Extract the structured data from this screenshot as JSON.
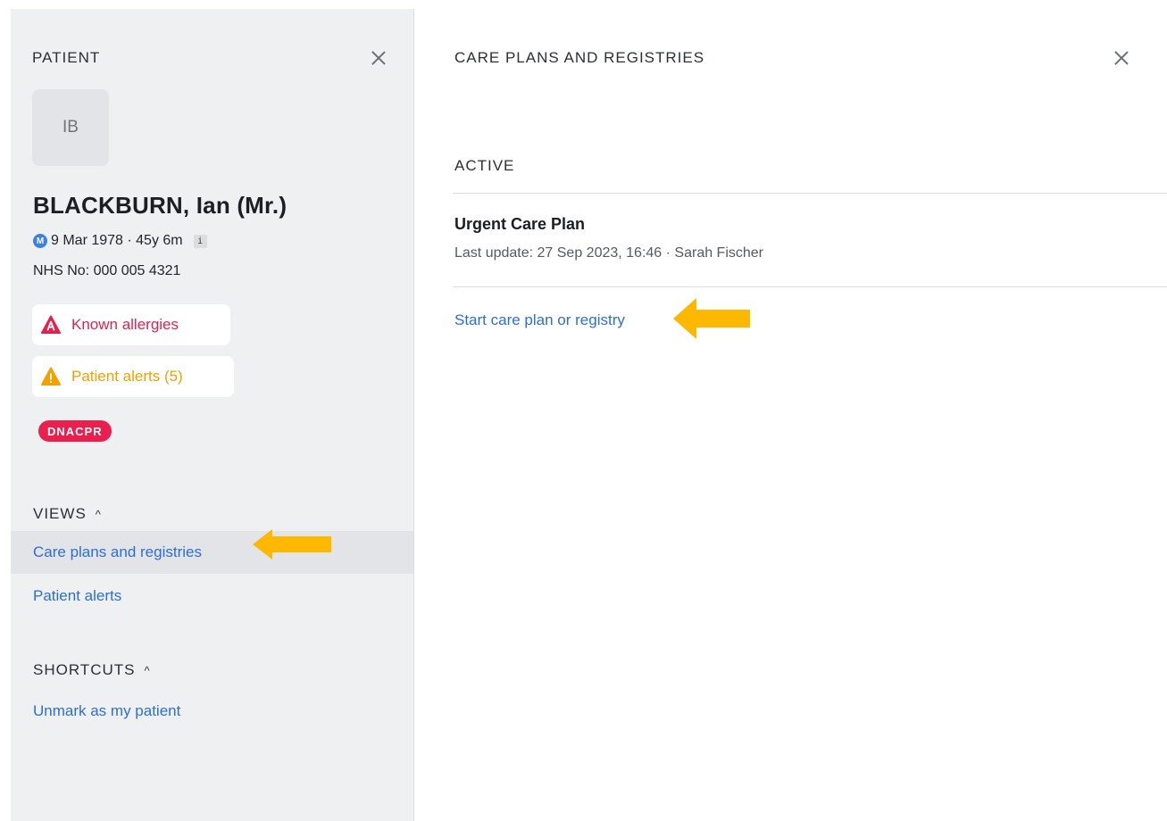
{
  "patient_panel": {
    "title": "PATIENT",
    "avatar_initials": "IB",
    "name": "BLACKBURN,  Ian  (Mr.)",
    "gender_badge": "M",
    "dob": "9 Mar 1978 · 45y 6m",
    "info_badge": "i",
    "nhs": "NHS No: 000 005 4321",
    "allergies_label": "Known allergies",
    "alerts_label": "Patient alerts (5)",
    "dnacpr_label": "DNACPR",
    "views_title": "VIEWS",
    "views_items": [
      "Care plans and registries",
      "Patient alerts"
    ],
    "shortcuts_title": "SHORTCUTS",
    "shortcuts_items": [
      "Unmark as my patient"
    ],
    "caret": "^"
  },
  "care_panel": {
    "title": "CARE PLANS AND REGISTRIES",
    "active_label": "ACTIVE",
    "plan": {
      "title": "Urgent Care Plan",
      "meta": "Last update: 27 Sep 2023, 16:46 · Sarah Fischer"
    },
    "start_link": "Start care plan or registry"
  },
  "colors": {
    "link": "#2d6fd0",
    "allergy_red": "#e0234d",
    "alert_orange": "#f3a000",
    "dnacpr_red": "#ea1f4e",
    "arrow_yellow": "#ffb800",
    "panel_bg": "#eff0f2"
  },
  "icons": {
    "close": "close-icon",
    "allergy": "allergy-warning-icon",
    "alert": "alert-warning-icon",
    "arrow": "yellow-arrow-left-icon"
  }
}
